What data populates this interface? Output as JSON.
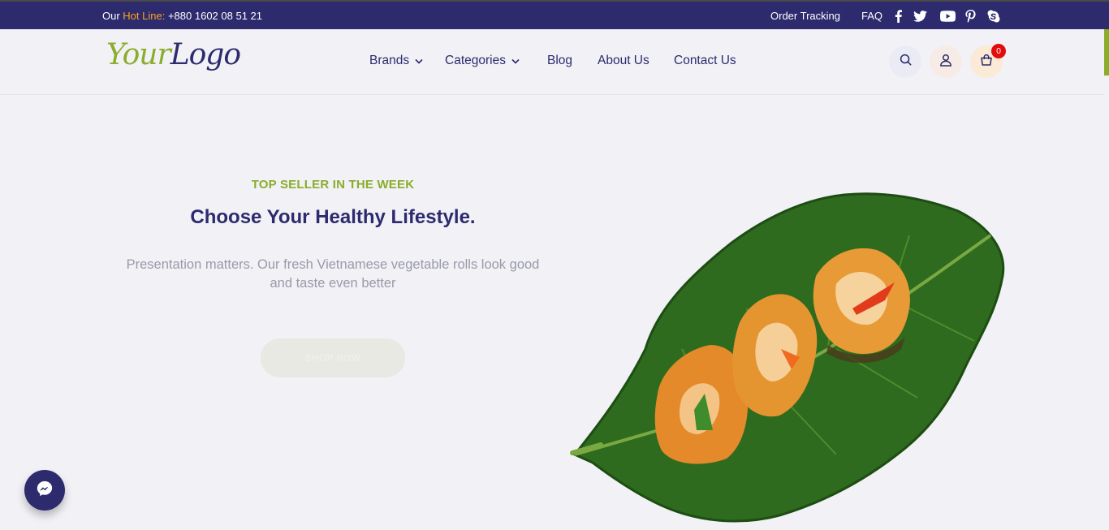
{
  "topbar": {
    "hotline_prefix": "Our",
    "hotline_label": "Hot Line:",
    "hotline_number": "+880 1602 08 51 21",
    "links": [
      {
        "label": "Order Tracking"
      },
      {
        "label": "FAQ"
      }
    ],
    "social_icons": [
      "facebook-icon",
      "twitter-icon",
      "youtube-icon",
      "pinterest-icon",
      "skype-icon"
    ]
  },
  "header": {
    "logo_part1": "Your",
    "logo_part2": "Logo",
    "nav": [
      {
        "label": "Brands",
        "has_dropdown": true
      },
      {
        "label": "Categories",
        "has_dropdown": true
      },
      {
        "label": "Blog",
        "has_dropdown": false
      },
      {
        "label": "About Us",
        "has_dropdown": false
      },
      {
        "label": "Contact Us",
        "has_dropdown": false
      }
    ],
    "cart_count": "0"
  },
  "hero": {
    "eyebrow": "TOP SELLER IN THE WEEK",
    "title": "Choose Your Healthy Lifestyle.",
    "description": "Presentation matters. Our fresh Vietnamese vegetable rolls look good and taste even better",
    "cta_label": "SHOP NOW"
  },
  "colors": {
    "primary": "#2d2a6e",
    "accent_green": "#8aad2b",
    "hotline_orange": "#f6a51b",
    "badge_red": "#e30b0b",
    "background": "#f1f1f6"
  }
}
